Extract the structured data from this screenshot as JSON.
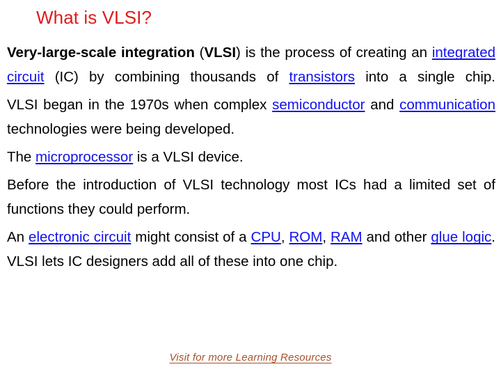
{
  "slide": {
    "title": "What is VLSI?",
    "title_color": "#E01B1B",
    "link_color": "#1111EE",
    "footer_color": "#A5522B",
    "background_color": "#FFFFFF"
  },
  "paragraphs": {
    "p1": {
      "bold_lead": "Very-large-scale integration",
      "open_paren": " (",
      "bold_acronym": "VLSI",
      "after_acronym": ") is the process of creating an ",
      "link1": "integrated circuit",
      "mid": " (IC) by combining thousands of ",
      "link2": "transistors",
      "tail": " into a single chip."
    },
    "p2": {
      "lead": " VLSI began in the 1970s when complex ",
      "link1": "semiconductor",
      "mid": " and ",
      "link2": "communication",
      "tail": " technologies were being developed."
    },
    "p3": {
      "lead": "The ",
      "link1": "microprocessor",
      "tail": " is a VLSI device."
    },
    "p4": {
      "text": "Before the introduction of VLSI technology most ICs had a limited set of functions they could perform."
    },
    "p5": {
      "lead": "An ",
      "link1": "electronic circuit",
      "mid1": " might consist of a ",
      "link2": "CPU",
      "sep1": ", ",
      "link3": "ROM",
      "sep2": ", ",
      "link4": "RAM",
      "mid2": " and other ",
      "link5": "glue logic",
      "tail": ". VLSI lets IC designers add all of these into one chip."
    }
  },
  "footer": {
    "label": "Visit for more Learning Resources"
  }
}
